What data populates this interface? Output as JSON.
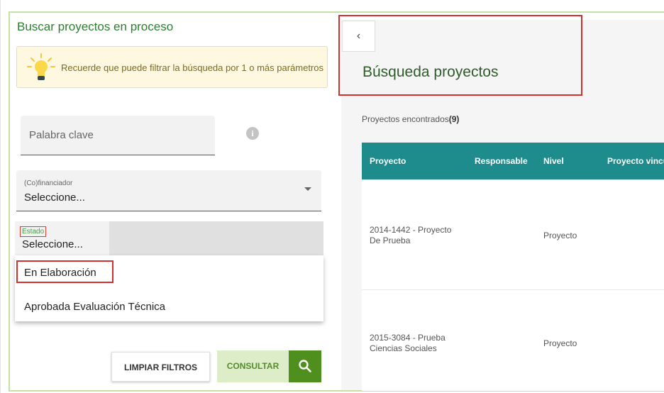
{
  "left": {
    "title": "Buscar proyectos en proceso",
    "hint_text": "Recuerde que puede filtrar la búsqueda por 1 o más parámetros",
    "keyword_field": {
      "label": "Palabra clave"
    },
    "cofinanciador_field": {
      "label": "(Co)financiador",
      "value": "Seleccione..."
    },
    "estado_field": {
      "label": "Estado",
      "value": "Seleccione..."
    },
    "estado_options": [
      "En Elaboración",
      "Aprobada Evaluación Técnica"
    ],
    "buttons": {
      "clear": "LIMPIAR FILTROS",
      "consult": "CONSULTAR"
    }
  },
  "right": {
    "back_glyph": "‹",
    "title": "Búsqueda proyectos",
    "found_label": "Proyectos encontrados",
    "found_count": "(9)",
    "columns": [
      "Proyecto",
      "Responsable",
      "Nivel",
      "Proyecto vincu"
    ],
    "rows": [
      {
        "proyecto_line1": "2014-1442 - Proyecto",
        "proyecto_line2": "De Prueba",
        "nivel": "Proyecto"
      },
      {
        "proyecto_line1": "2015-3084 - Prueba",
        "proyecto_line2": "Ciencias Sociales",
        "nivel": "Proyecto"
      }
    ]
  },
  "colors": {
    "accent_green": "#4f8f1e",
    "header_teal": "#1e8c8c",
    "highlight_red": "#d32f2f"
  },
  "icons": [
    "lightbulb-icon",
    "info-icon",
    "dropdown-caret-icon",
    "search-icon",
    "back-chevron-icon"
  ]
}
